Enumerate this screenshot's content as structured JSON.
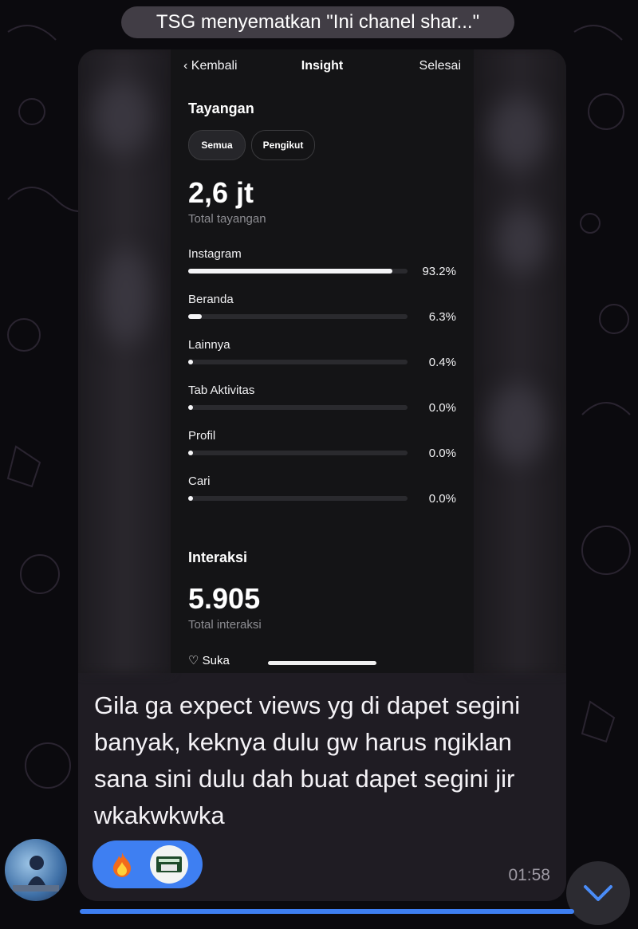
{
  "pinned": {
    "text": "TSG menyematkan \"Ini chanel shar...\""
  },
  "insight": {
    "nav": {
      "back": "Kembali",
      "title": "Insight",
      "done": "Selesai"
    },
    "tayangan": {
      "title": "Tayangan",
      "chips": [
        "Semua",
        "Pengikut"
      ],
      "total_value": "2,6 jt",
      "total_label": "Total tayangan",
      "rows": [
        {
          "label": "Instagram",
          "pct": "93.2%",
          "fraction": 0.932
        },
        {
          "label": "Beranda",
          "pct": "6.3%",
          "fraction": 0.063
        },
        {
          "label": "Lainnya",
          "pct": "0.4%",
          "fraction": 0.004
        },
        {
          "label": "Tab Aktivitas",
          "pct": "0.0%",
          "fraction": 0.0
        },
        {
          "label": "Profil",
          "pct": "0.0%",
          "fraction": 0.0
        },
        {
          "label": "Cari",
          "pct": "0.0%",
          "fraction": 0.0
        }
      ]
    },
    "interaksi": {
      "title": "Interaksi",
      "total_value": "5.905",
      "total_label": "Total interaksi",
      "first_row": "Suka"
    }
  },
  "message": {
    "text": "Gila ga expect views yg di dapet segini banyak, keknya dulu gw harus ngiklan sana sini dulu dah buat dapet segini jir wkakwkwka",
    "time": "01:58",
    "reaction_icon": "fire-emoji"
  },
  "colors": {
    "accent": "#3e7ff2",
    "bubble": "#1f1c23",
    "background": "#0b0a0e"
  }
}
